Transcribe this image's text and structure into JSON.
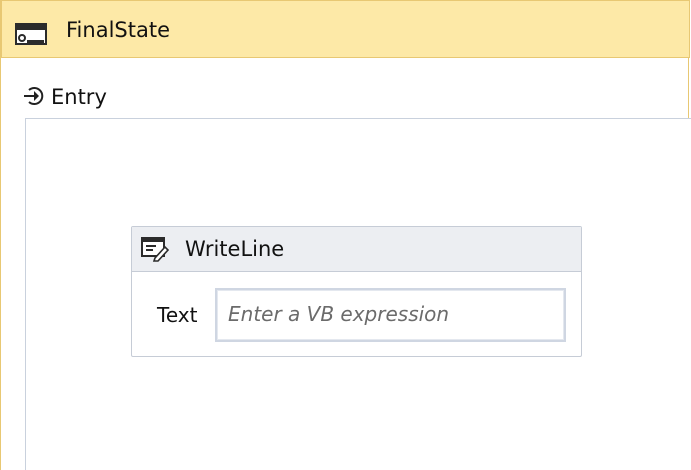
{
  "state": {
    "title": "FinalState",
    "icon": "state-icon"
  },
  "entry": {
    "label": "Entry",
    "icon": "entry-arrow-icon"
  },
  "activity": {
    "title": "WriteLine",
    "icon": "writeline-icon",
    "property_label": "Text",
    "property_placeholder": "Enter a VB expression",
    "property_value": ""
  },
  "colors": {
    "state_header_bg": "#fde9a7",
    "state_border": "#e8c873",
    "activity_header_bg": "#eceef2",
    "activity_border": "#c6ccd6",
    "input_border": "#cfd6e2"
  }
}
